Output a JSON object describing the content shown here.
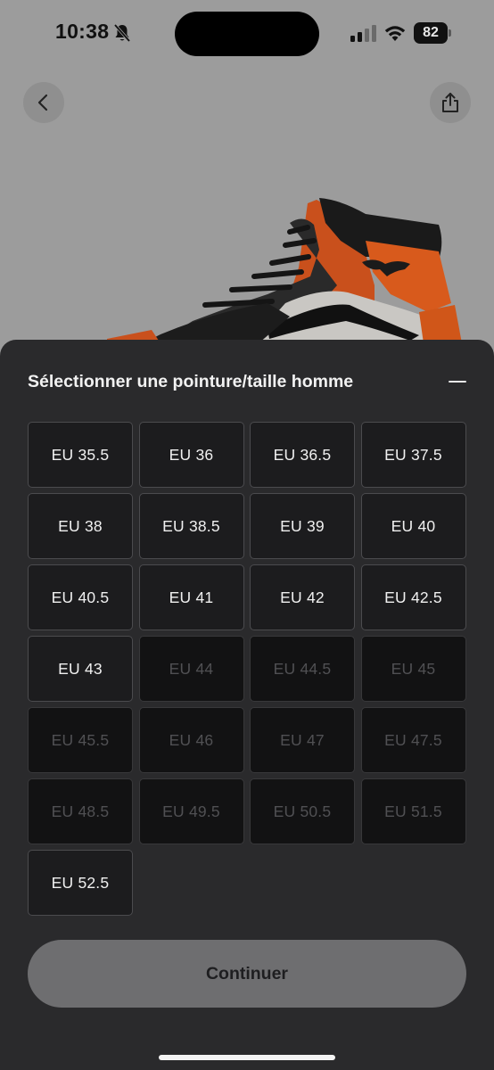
{
  "status_bar": {
    "time": "10:38",
    "battery": "82",
    "icons": [
      "bell-off-icon",
      "signal-icon",
      "wifi-icon",
      "battery-icon"
    ]
  },
  "nav": {
    "back_icon": "chevron-left-icon",
    "share_icon": "share-icon"
  },
  "sheet": {
    "title": "Sélectionner une pointure/taille homme",
    "collapse_icon": "minus-icon",
    "sizes": [
      {
        "label": "EU 35.5",
        "available": true
      },
      {
        "label": "EU 36",
        "available": true
      },
      {
        "label": "EU 36.5",
        "available": true
      },
      {
        "label": "EU 37.5",
        "available": true
      },
      {
        "label": "EU 38",
        "available": true
      },
      {
        "label": "EU 38.5",
        "available": true
      },
      {
        "label": "EU 39",
        "available": true
      },
      {
        "label": "EU 40",
        "available": true
      },
      {
        "label": "EU 40.5",
        "available": true
      },
      {
        "label": "EU 41",
        "available": true
      },
      {
        "label": "EU 42",
        "available": true
      },
      {
        "label": "EU 42.5",
        "available": true
      },
      {
        "label": "EU 43",
        "available": true
      },
      {
        "label": "EU 44",
        "available": false
      },
      {
        "label": "EU 44.5",
        "available": false
      },
      {
        "label": "EU 45",
        "available": false
      },
      {
        "label": "EU 45.5",
        "available": false
      },
      {
        "label": "EU 46",
        "available": false
      },
      {
        "label": "EU 47",
        "available": false
      },
      {
        "label": "EU 47.5",
        "available": false
      },
      {
        "label": "EU 48.5",
        "available": false
      },
      {
        "label": "EU 49.5",
        "available": false
      },
      {
        "label": "EU 50.5",
        "available": false
      },
      {
        "label": "EU 51.5",
        "available": false
      },
      {
        "label": "EU 52.5",
        "available": true
      }
    ],
    "continue_label": "Continuer"
  },
  "colors": {
    "sheet_bg": "#2a2a2c",
    "available_bg": "#1c1c1e",
    "unavailable_bg": "#121213",
    "shoe_orange": "#d9541a",
    "continue_bg": "#6e6e70"
  }
}
